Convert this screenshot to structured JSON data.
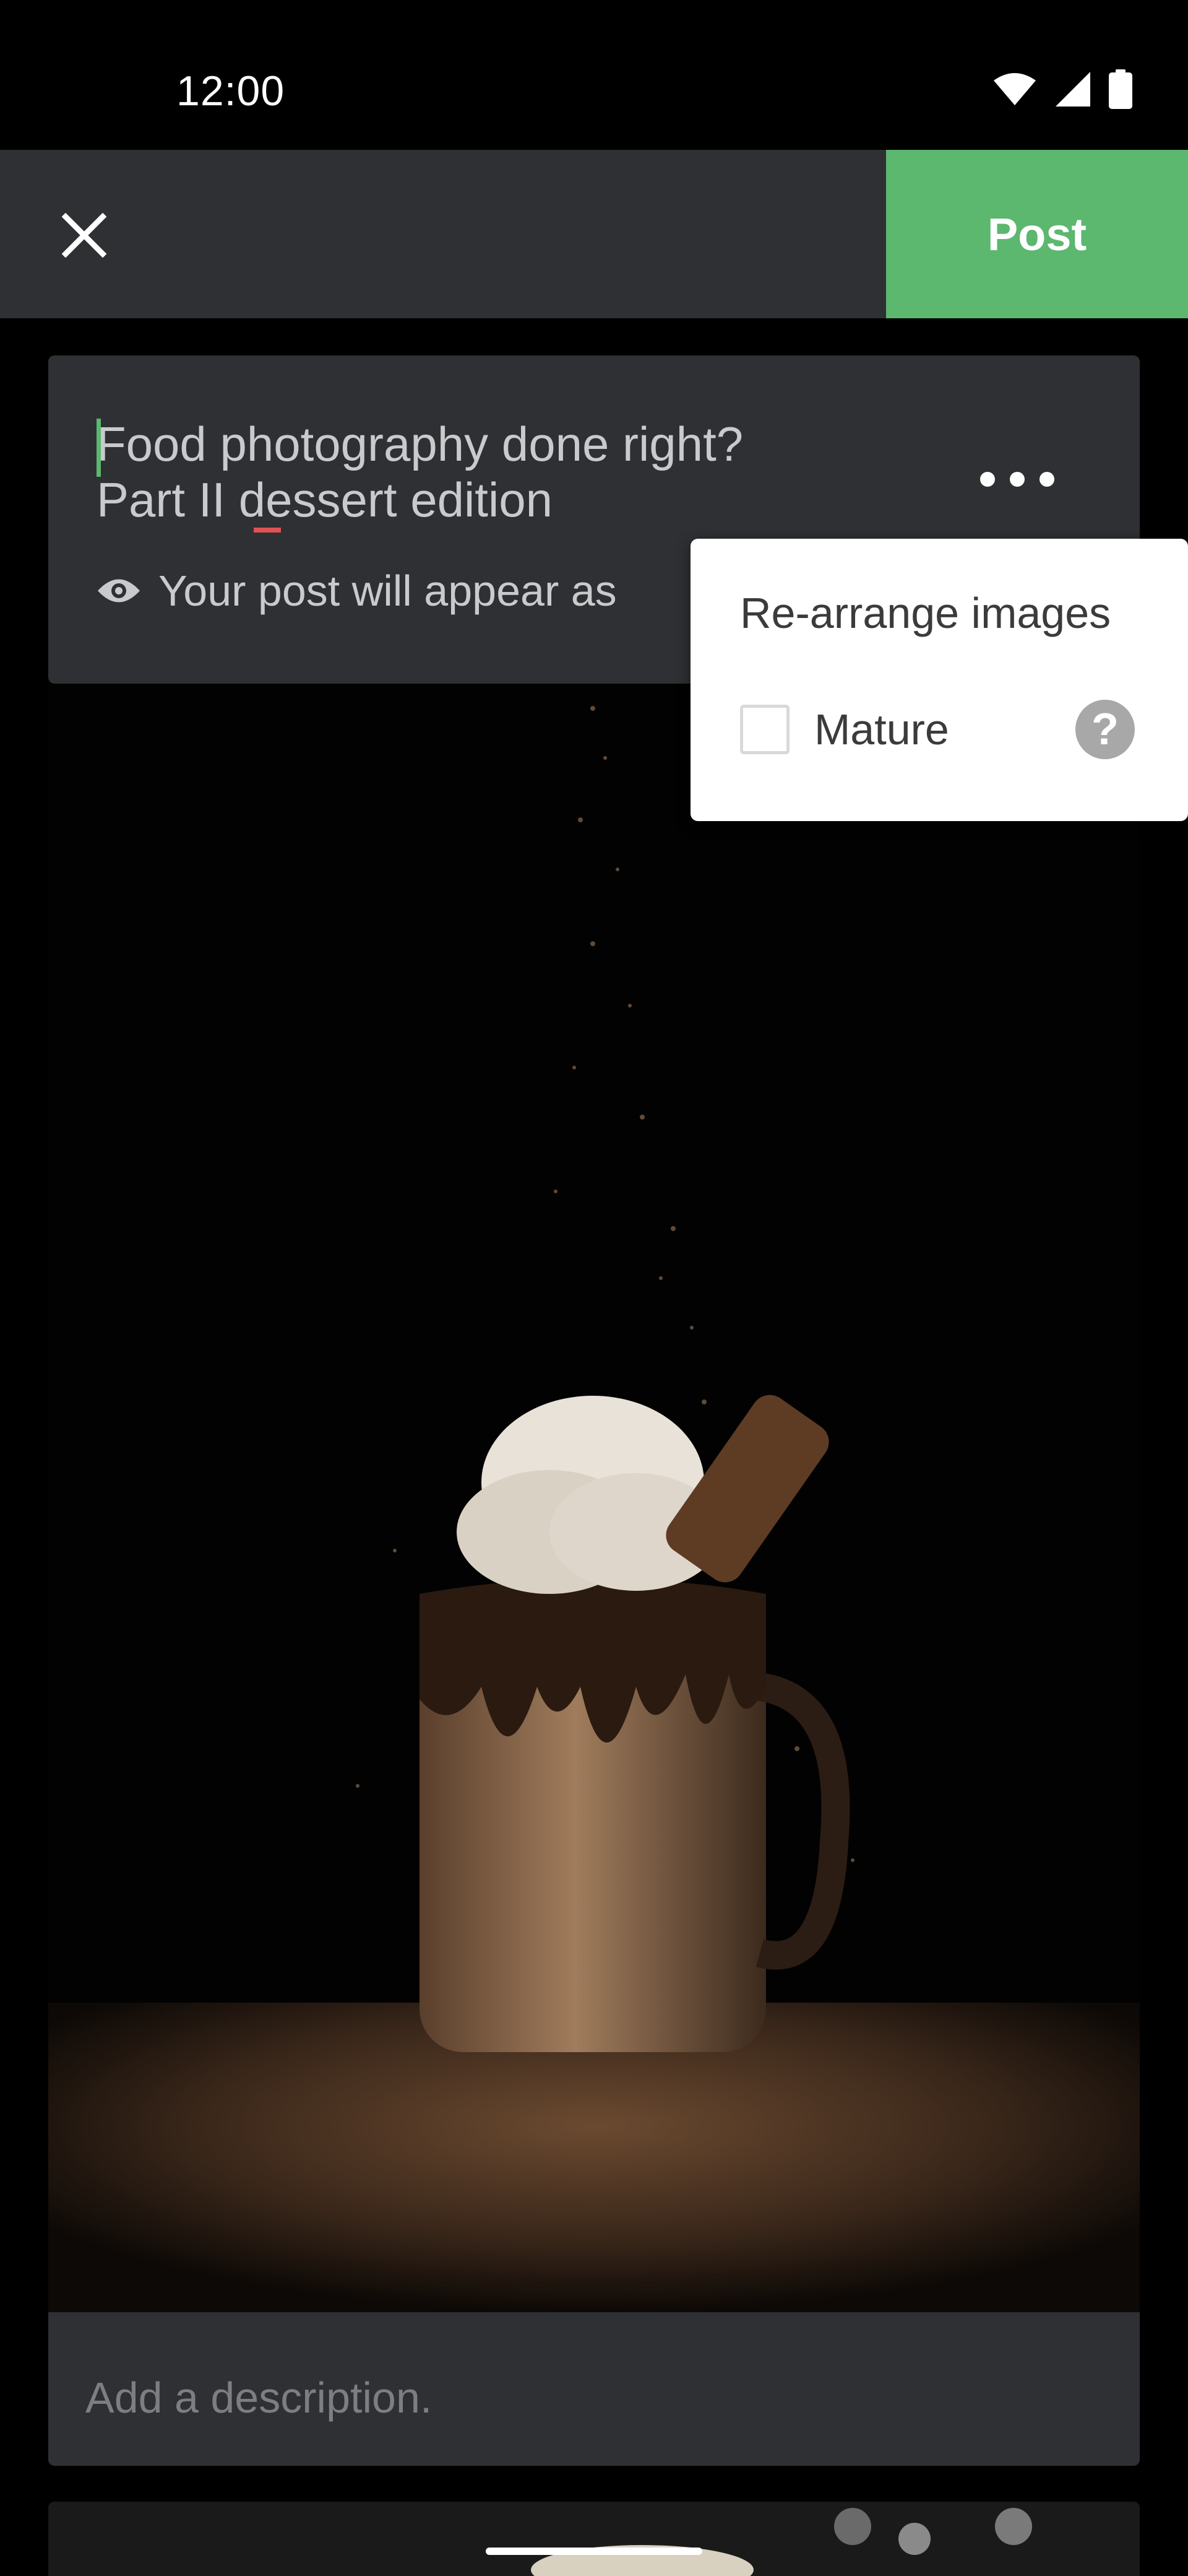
{
  "status_bar": {
    "time": "12:00"
  },
  "app_bar": {
    "post_label": "Post"
  },
  "post": {
    "title": "Food photography done right?\nPart II dessert edition",
    "visibility_text": "Your post will appear as",
    "description_placeholder": "Add a description."
  },
  "menu": {
    "rearrange_label": "Re-arrange images",
    "mature_label": "Mature",
    "mature_checked": false,
    "help_symbol": "?"
  },
  "colors": {
    "accent_green": "#5cb76f",
    "card_gray": "#2f3033",
    "spellcheck_red": "#e05252"
  },
  "icons": [
    "wifi-icon",
    "signal-icon",
    "battery-icon",
    "close-icon",
    "more-icon",
    "eye-icon",
    "help-icon"
  ]
}
